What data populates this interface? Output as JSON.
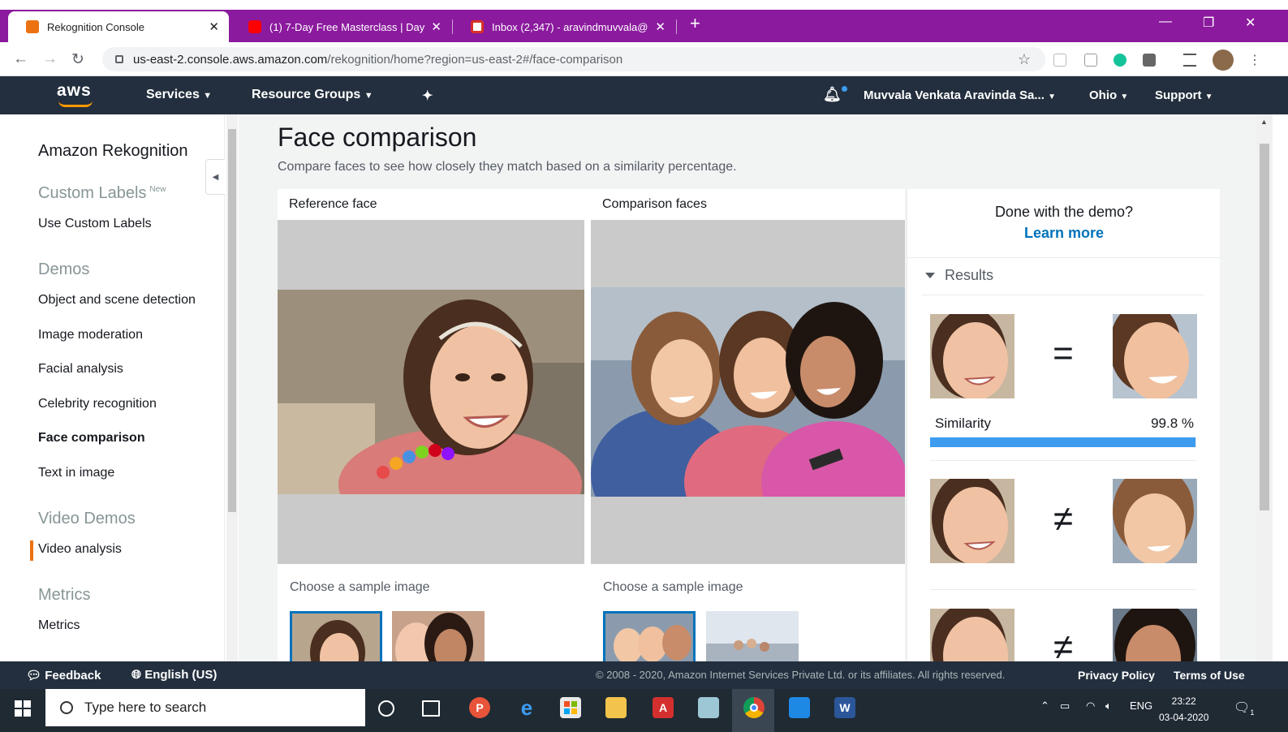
{
  "browser": {
    "tabs": [
      {
        "title": "Rekognition Console",
        "active": true,
        "favicon_color": "#ec7211"
      },
      {
        "title": "(1) 7-Day Free Masterclass | Day",
        "active": false,
        "favicon_color": "#ff0000"
      },
      {
        "title": "Inbox (2,347) - aravindmuvvala@",
        "active": false,
        "favicon_color": "#d93025"
      }
    ],
    "new_tab": "+",
    "url_host": "us-east-2.console.aws.amazon.com",
    "url_path": "/rekognition/home?region=us-east-2#/face-comparison",
    "tabstrip_color": "#8b1a9e"
  },
  "aws_nav": {
    "logo": "aws",
    "services": "Services",
    "resource_groups": "Resource Groups",
    "account": "Muvvala Venkata Aravinda Sa...",
    "region": "Ohio",
    "support": "Support"
  },
  "sidebar": {
    "brand": "Amazon Rekognition",
    "custom_labels": {
      "title": "Custom Labels",
      "badge": "New",
      "items": [
        "Use Custom Labels"
      ]
    },
    "demos": {
      "title": "Demos",
      "items": [
        "Object and scene detection",
        "Image moderation",
        "Facial analysis",
        "Celebrity recognition",
        "Face comparison",
        "Text in image"
      ]
    },
    "video_demos": {
      "title": "Video Demos",
      "items": [
        "Video analysis"
      ]
    },
    "metrics": {
      "title": "Metrics",
      "items": [
        "Metrics"
      ]
    },
    "active_item": "Face comparison"
  },
  "main": {
    "title": "Face comparison",
    "description": "Compare faces to see how closely they match based on a similarity percentage.",
    "reference_label": "Reference face",
    "comparison_label": "Comparison faces",
    "sample_label_ref": "Choose a sample image",
    "sample_label_cmp": "Choose a sample image"
  },
  "results": {
    "done_text": "Done with the demo?",
    "learn_more": "Learn more",
    "heading": "Results",
    "match_symbol": "=",
    "nonmatch_symbol": "≠",
    "similarity_label": "Similarity",
    "similarity_value": "99.8 %",
    "similarity_fraction": 0.998
  },
  "footer": {
    "feedback": "Feedback",
    "language": "English (US)",
    "copyright": "© 2008 - 2020, Amazon Internet Services Private Ltd. or its affiliates. All rights reserved.",
    "privacy": "Privacy Policy",
    "terms": "Terms of Use"
  },
  "taskbar": {
    "search_placeholder": "Type here to search",
    "language": "ENG",
    "time": "23:22",
    "date": "03-04-2020",
    "notification_count": "1"
  }
}
